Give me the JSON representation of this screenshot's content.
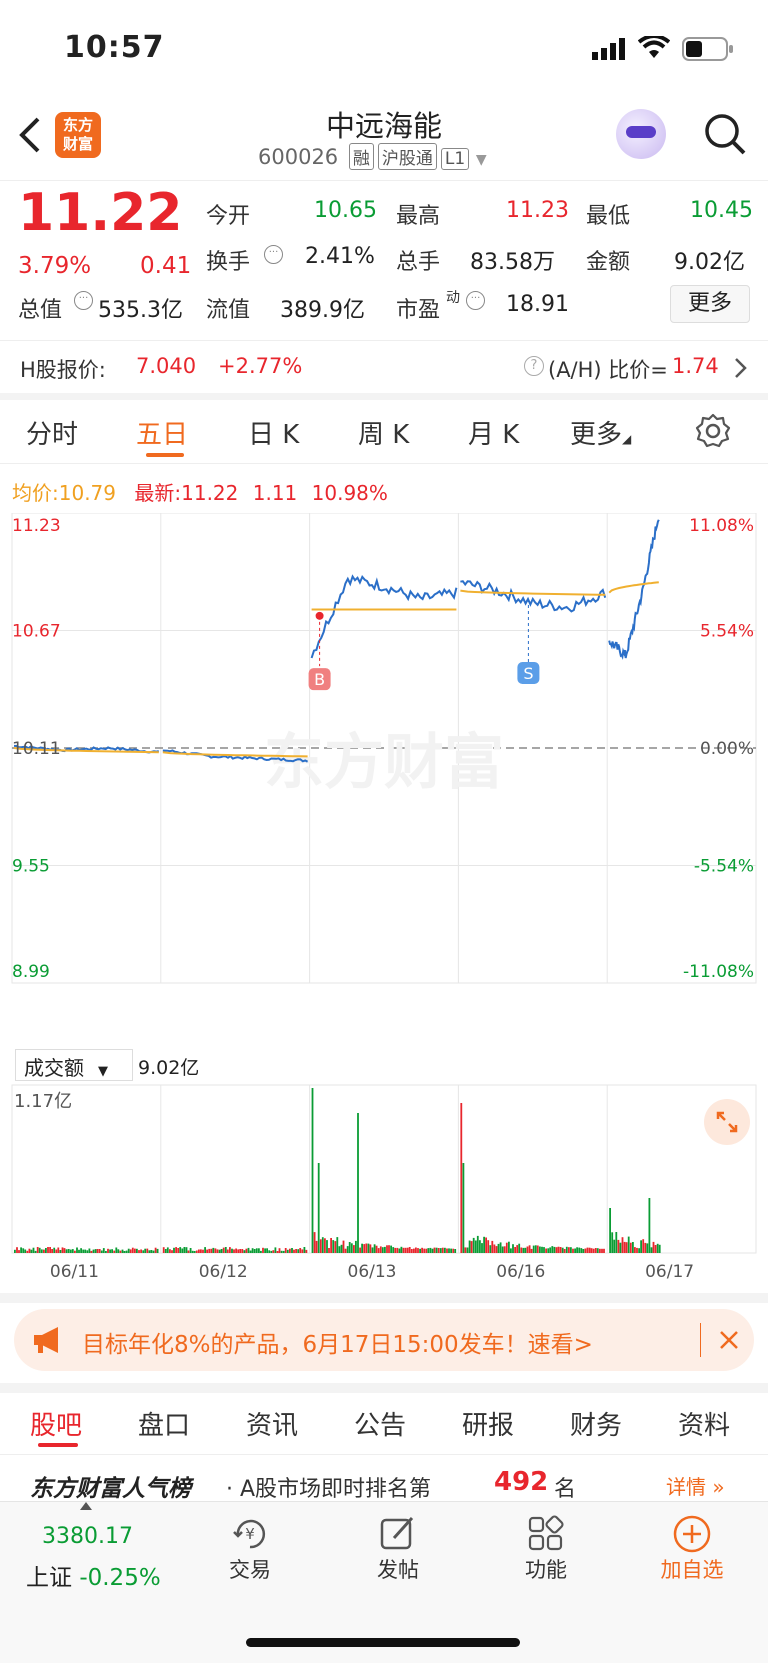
{
  "status": {
    "time": "10:57"
  },
  "header": {
    "logo": "东方\n财富",
    "title": "中远海能",
    "code": "600026",
    "tags": [
      "融",
      "沪股通",
      "L1"
    ]
  },
  "quote": {
    "price": "11.22",
    "pct": "3.79%",
    "chg": "0.41",
    "open_label": "今开",
    "open": "10.65",
    "high_label": "最高",
    "high": "11.23",
    "low_label": "最低",
    "low": "10.45",
    "turnover_label": "换手",
    "turnover": "2.41%",
    "volume_label": "总手",
    "volume": "83.58万",
    "amount_label": "金额",
    "amount": "9.02亿",
    "mktcap_label": "总值",
    "mktcap": "535.3亿",
    "float_label": "流值",
    "float": "389.9亿",
    "pe_label": "市盈",
    "pe_sup": "动",
    "pe": "18.91",
    "more_button": "更多"
  },
  "hshare": {
    "label": "H股报价:",
    "price": "7.040",
    "pct": "+2.77%",
    "ratio_label": "(A/H) 比价=",
    "ratio": "1.74"
  },
  "chart_tabs": [
    "分时",
    "五日",
    "日 K",
    "周 K",
    "月 K",
    "更多"
  ],
  "active_tab": 1,
  "chart_info": {
    "avg_label": "均价:",
    "avg": "10.79",
    "last_label": "最新:",
    "last": "11.22",
    "chg": "1.11",
    "pct": "10.98%"
  },
  "chart_data": {
    "type": "line",
    "x": [
      "06/11",
      "06/12",
      "06/13",
      "06/16",
      "06/17"
    ],
    "y_ticks_left": [
      "11.23",
      "10.67",
      "10.11",
      "9.55",
      "8.99"
    ],
    "y_ticks_right": [
      "11.08%",
      "5.54%",
      "0.00%",
      "-5.54%",
      "-11.08%"
    ],
    "ylim": [
      8.99,
      11.23
    ],
    "series": [
      {
        "values": [
          10.11,
          10.08,
          10.05,
          10.7,
          10.95,
          10.92,
          10.85,
          10.72,
          11.22
        ]
      },
      {
        "values": [
          10.11,
          10.09,
          10.06,
          10.72,
          10.77,
          10.86,
          10.85,
          10.75,
          10.9
        ]
      }
    ],
    "markers": [
      "B",
      "S"
    ],
    "watermark": "东方财富"
  },
  "volume": {
    "label": "成交额",
    "value": "9.02亿",
    "max": "1.17亿"
  },
  "banner": {
    "text": "目标年化8%的产品，6月17日15:00发车！速看>"
  },
  "sub_tabs": [
    "股吧",
    "盘口",
    "资讯",
    "公告",
    "研报",
    "财务",
    "资料"
  ],
  "rank": {
    "title": "东方财富人气榜",
    "text": "· A股市场即时排名第",
    "num": "492",
    "suffix": "名",
    "detail": "详情"
  },
  "bottom": {
    "index_value": "3380.17",
    "index_name": "上证",
    "index_pct": "-0.25%",
    "items": [
      "交易",
      "发帖",
      "功能",
      "加自选"
    ]
  },
  "colors": {
    "up": "#e8262d",
    "down": "#0a9c34",
    "accent": "#f06a1f",
    "line": "#2b6fc8",
    "avg": "#f0b030"
  }
}
